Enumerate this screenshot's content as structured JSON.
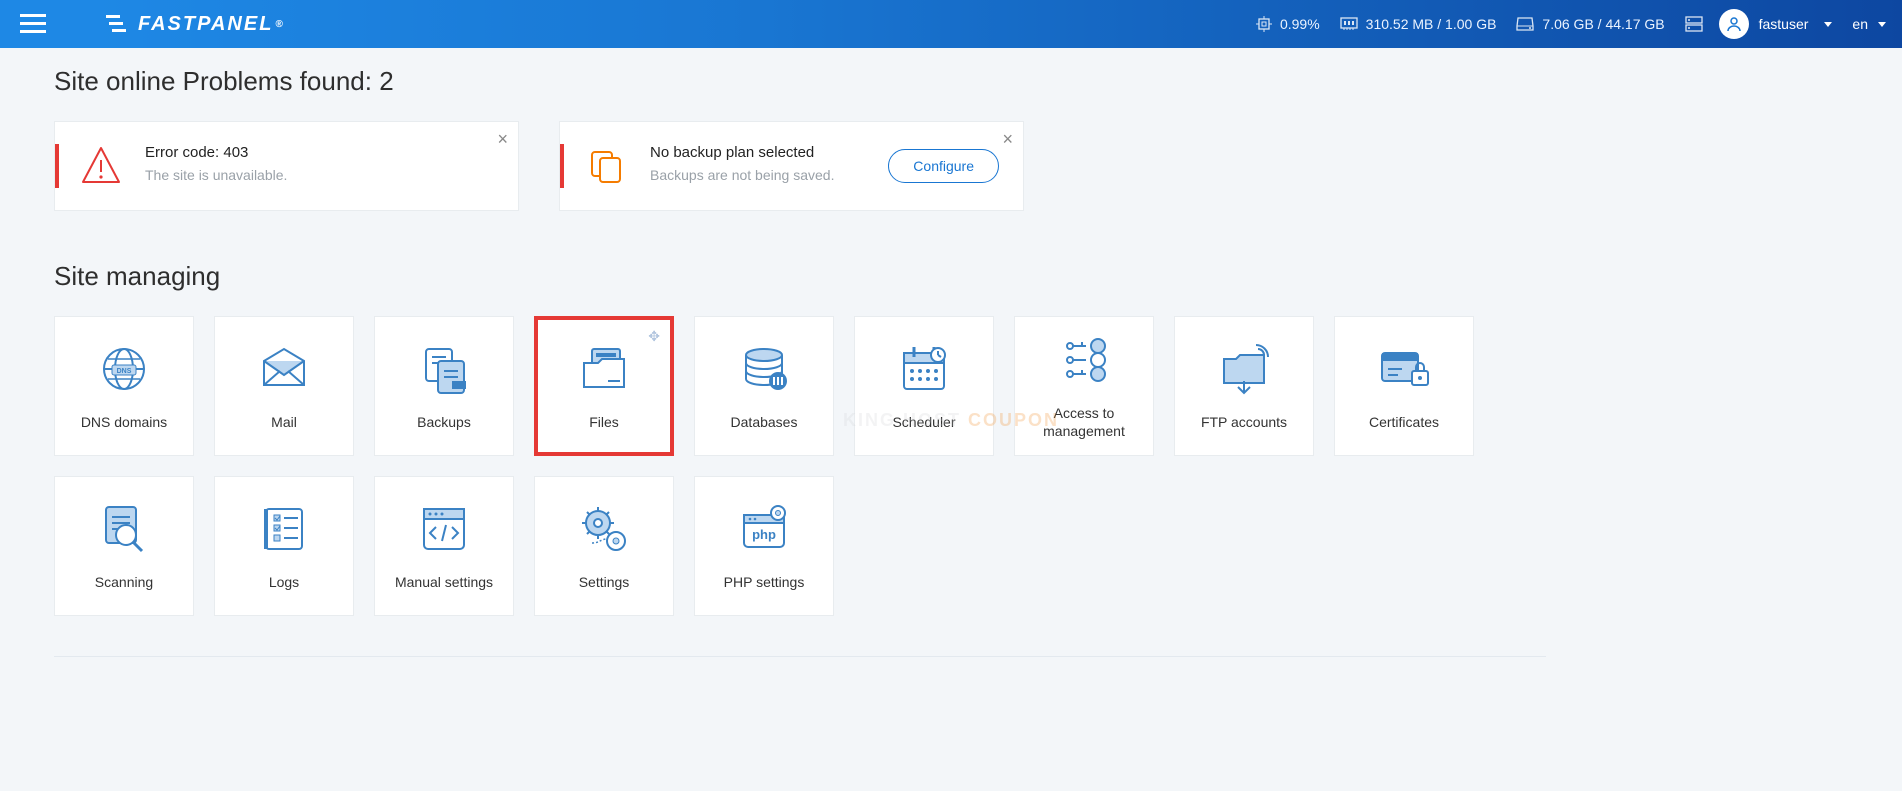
{
  "brand": "FASTPANEL",
  "topbar": {
    "cpu": "0.99%",
    "ram": "310.52 MB / 1.00 GB",
    "disk": "7.06 GB / 44.17 GB",
    "username": "fastuser",
    "lang": "en"
  },
  "problems": {
    "heading": "Site online Problems found: 2",
    "err": {
      "title": "Error code: 403",
      "sub": "The site is unavailable."
    },
    "backup": {
      "title": "No backup plan selected",
      "sub": "Backups are not being saved.",
      "btn": "Configure"
    }
  },
  "managing": {
    "heading": "Site managing",
    "tiles": [
      {
        "id": "dns",
        "label": "DNS domains"
      },
      {
        "id": "mail",
        "label": "Mail"
      },
      {
        "id": "back",
        "label": "Backups"
      },
      {
        "id": "files",
        "label": "Files",
        "highlight": true
      },
      {
        "id": "db",
        "label": "Databases"
      },
      {
        "id": "sched",
        "label": "Scheduler"
      },
      {
        "id": "access",
        "label": "Access to management"
      },
      {
        "id": "ftp",
        "label": "FTP accounts"
      },
      {
        "id": "cert",
        "label": "Certificates"
      },
      {
        "id": "scan",
        "label": "Scanning"
      },
      {
        "id": "logs",
        "label": "Logs"
      },
      {
        "id": "manual",
        "label": "Manual settings"
      },
      {
        "id": "set",
        "label": "Settings"
      },
      {
        "id": "php",
        "label": "PHP settings"
      }
    ]
  },
  "watermark": "KING HOST COUPON"
}
